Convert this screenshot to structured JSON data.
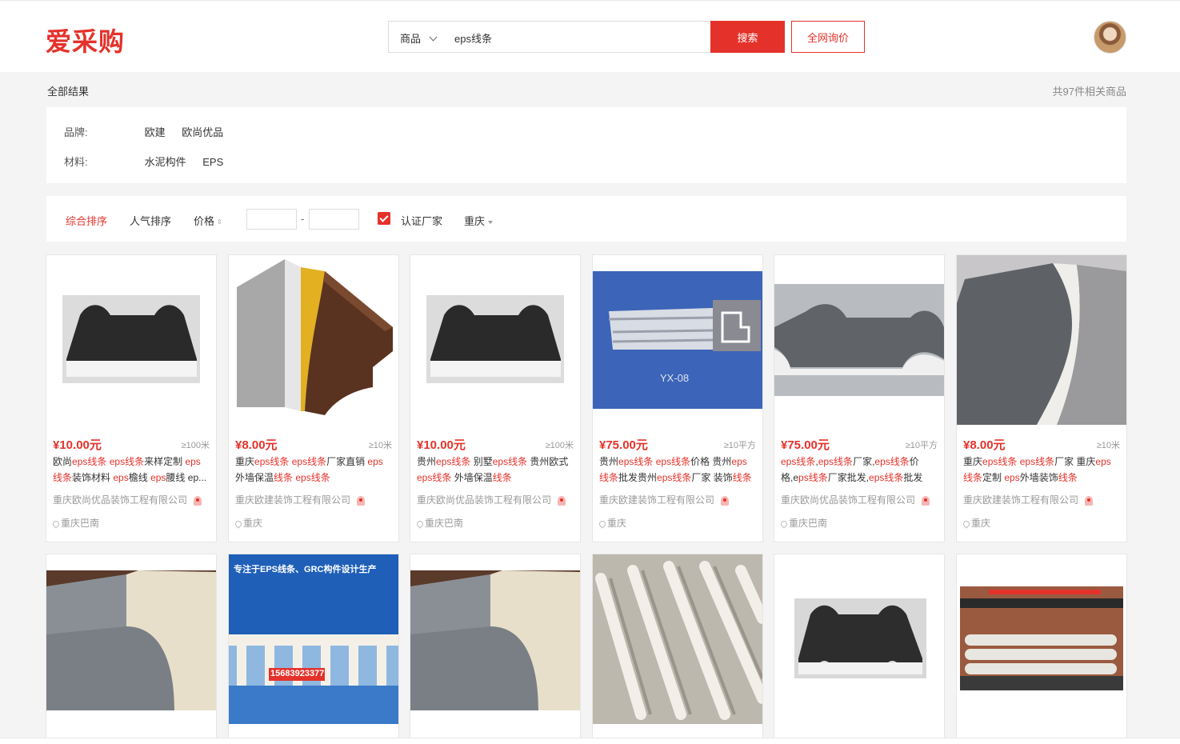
{
  "header": {
    "logo": "爱采购",
    "search_type": "商品",
    "search_value": "eps线条",
    "search_button": "搜索",
    "inquiry_button": "全网询价"
  },
  "results": {
    "crumb": "全部结果",
    "count": "共97件相关商品"
  },
  "filters": {
    "brand_label": "品牌:",
    "brands": [
      "欧建",
      "欧尚优品"
    ],
    "material_label": "材料:",
    "materials": [
      "水泥构件",
      "EPS"
    ]
  },
  "sort": {
    "comprehensive": "综合排序",
    "popularity": "人气排序",
    "price": "价格",
    "dash": "-",
    "certified": "认证厂家",
    "city": "重庆"
  },
  "products": [
    {
      "price": "¥10.00元",
      "unit": "≥100米",
      "title": [
        "欧尚",
        "eps线条",
        " ",
        "eps线条",
        "来样定制 ",
        "eps",
        " ",
        "线条",
        "装饰材料 ",
        "eps",
        "檐线 ",
        "eps",
        "腰线 ",
        "ep..."
      ],
      "company": "重庆欧尚优品装饰工程有限公司",
      "location": "重庆巴南"
    },
    {
      "price": "¥8.00元",
      "unit": "≥10米",
      "title": [
        "重庆",
        "eps线条",
        " ",
        "eps线条",
        "厂家直销 ",
        "eps",
        " 外墙保温",
        "线条",
        " ",
        "eps线条"
      ],
      "company": "重庆欧建装饰工程有限公司",
      "location": "重庆"
    },
    {
      "price": "¥10.00元",
      "unit": "≥100米",
      "title": [
        "贵州",
        "eps线条",
        " 别墅",
        "eps线条",
        " 贵州欧式 ",
        "eps线条",
        " 外墙保温",
        "线条"
      ],
      "company": "重庆欧尚优品装饰工程有限公司",
      "location": "重庆巴南"
    },
    {
      "price": "¥75.00元",
      "unit": "≥10平方",
      "title": [
        "贵州",
        "eps线条",
        " ",
        "eps线条",
        "价格 贵州",
        "eps",
        " ",
        "线条",
        "批发贵州",
        "eps线条",
        "厂家 装饰",
        "线条"
      ],
      "company": "重庆欧建装饰工程有限公司",
      "location": "重庆"
    },
    {
      "price": "¥75.00元",
      "unit": "≥10平方",
      "title": [
        "eps线条",
        ",",
        "eps线条",
        "厂家,",
        "eps线条",
        "价格,e",
        "ps线条",
        "厂家批发,",
        "eps线条",
        "批发"
      ],
      "company": "重庆欧尚优品装饰工程有限公司",
      "location": "重庆巴南"
    },
    {
      "price": "¥8.00元",
      "unit": "≥10米",
      "title": [
        "重庆",
        "eps线条",
        " ",
        "eps线条",
        "厂家 重庆",
        "eps",
        " ",
        "线条",
        "定制 ",
        "eps",
        "外墙装饰",
        "线条"
      ],
      "company": "重庆欧建装饰工程有限公司",
      "location": "重庆"
    }
  ],
  "promo": {
    "headline": "专注于EPS线条、GRC构件设计生产",
    "phone": "15683923377"
  },
  "product_image_caption": "YX-08"
}
